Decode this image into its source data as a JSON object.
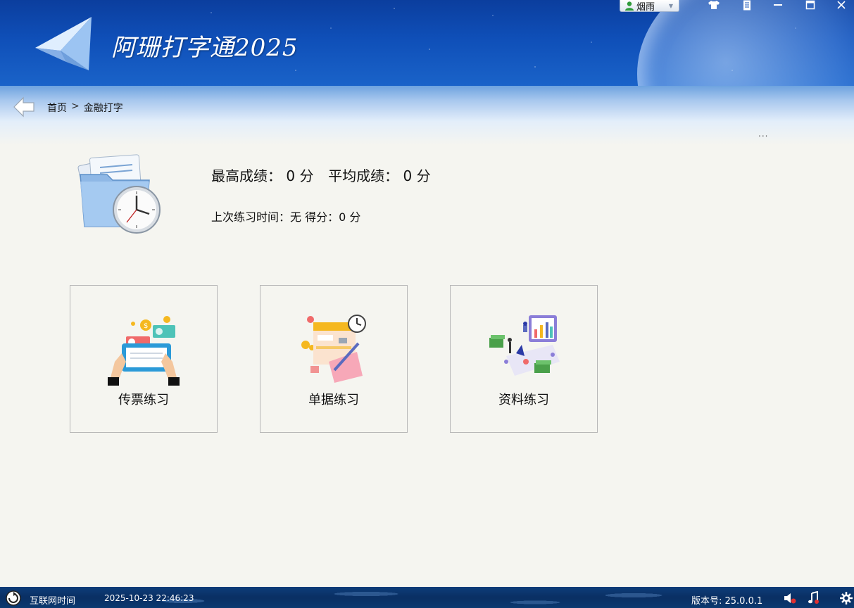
{
  "app": {
    "title": "阿珊打字通2025",
    "user_name": "烟雨"
  },
  "breadcrumb": {
    "home": "首页",
    "separator": ">",
    "current": "金融打字",
    "more": "..."
  },
  "scores": {
    "best_label": "最高成绩：",
    "best_value": "0",
    "avg_label": "平均成绩：",
    "avg_value": "0",
    "unit": "分",
    "last_time_label": "上次练习时间：",
    "last_time_value": "无",
    "last_score_label": "得分：",
    "last_score_value": "0"
  },
  "cards": [
    {
      "label": "传票练习",
      "icon": "voucher-practice-icon"
    },
    {
      "label": "单据练习",
      "icon": "receipt-practice-icon"
    },
    {
      "label": "资料练习",
      "icon": "data-practice-icon"
    }
  ],
  "footer": {
    "internet_time_label": "互联网时间",
    "datetime": "2025-10-23 22:46:23",
    "version_label": "版本号: 25.0.0.1"
  },
  "colors": {
    "header_blue": "#0f4fb8",
    "footer_blue": "#0a2f63",
    "background": "#f5f5f0"
  }
}
